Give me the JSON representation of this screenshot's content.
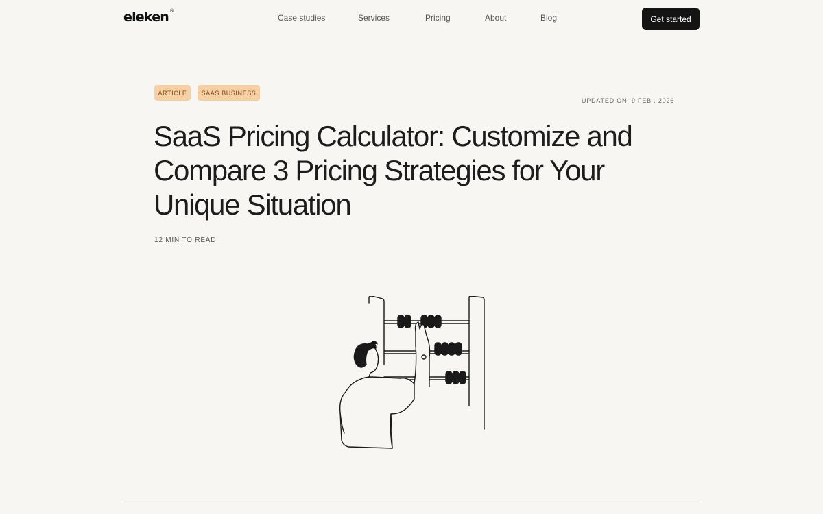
{
  "header": {
    "logo": "eleken",
    "logo_mark": "®",
    "nav": [
      "Case studies",
      "Services",
      "Pricing",
      "About",
      "Blog"
    ],
    "cta_label": "Get started"
  },
  "article": {
    "tags": [
      "ARTICLE",
      "SAAS BUSINESS"
    ],
    "updated": "UPDATED ON: 9 FEB , 2026",
    "title": "SaaS Pricing Calculator: Customize and Compare 3 Pricing Strategies for Your Unique Situation",
    "read_time": "12 MIN TO READ"
  },
  "illustration": {
    "icon": "person-with-abacus-illustration"
  },
  "colors": {
    "background": "#f8f6f2",
    "tag_bg": "#f6cfa2",
    "tag_text": "#7a4a1a",
    "cta_bg": "#141414"
  }
}
